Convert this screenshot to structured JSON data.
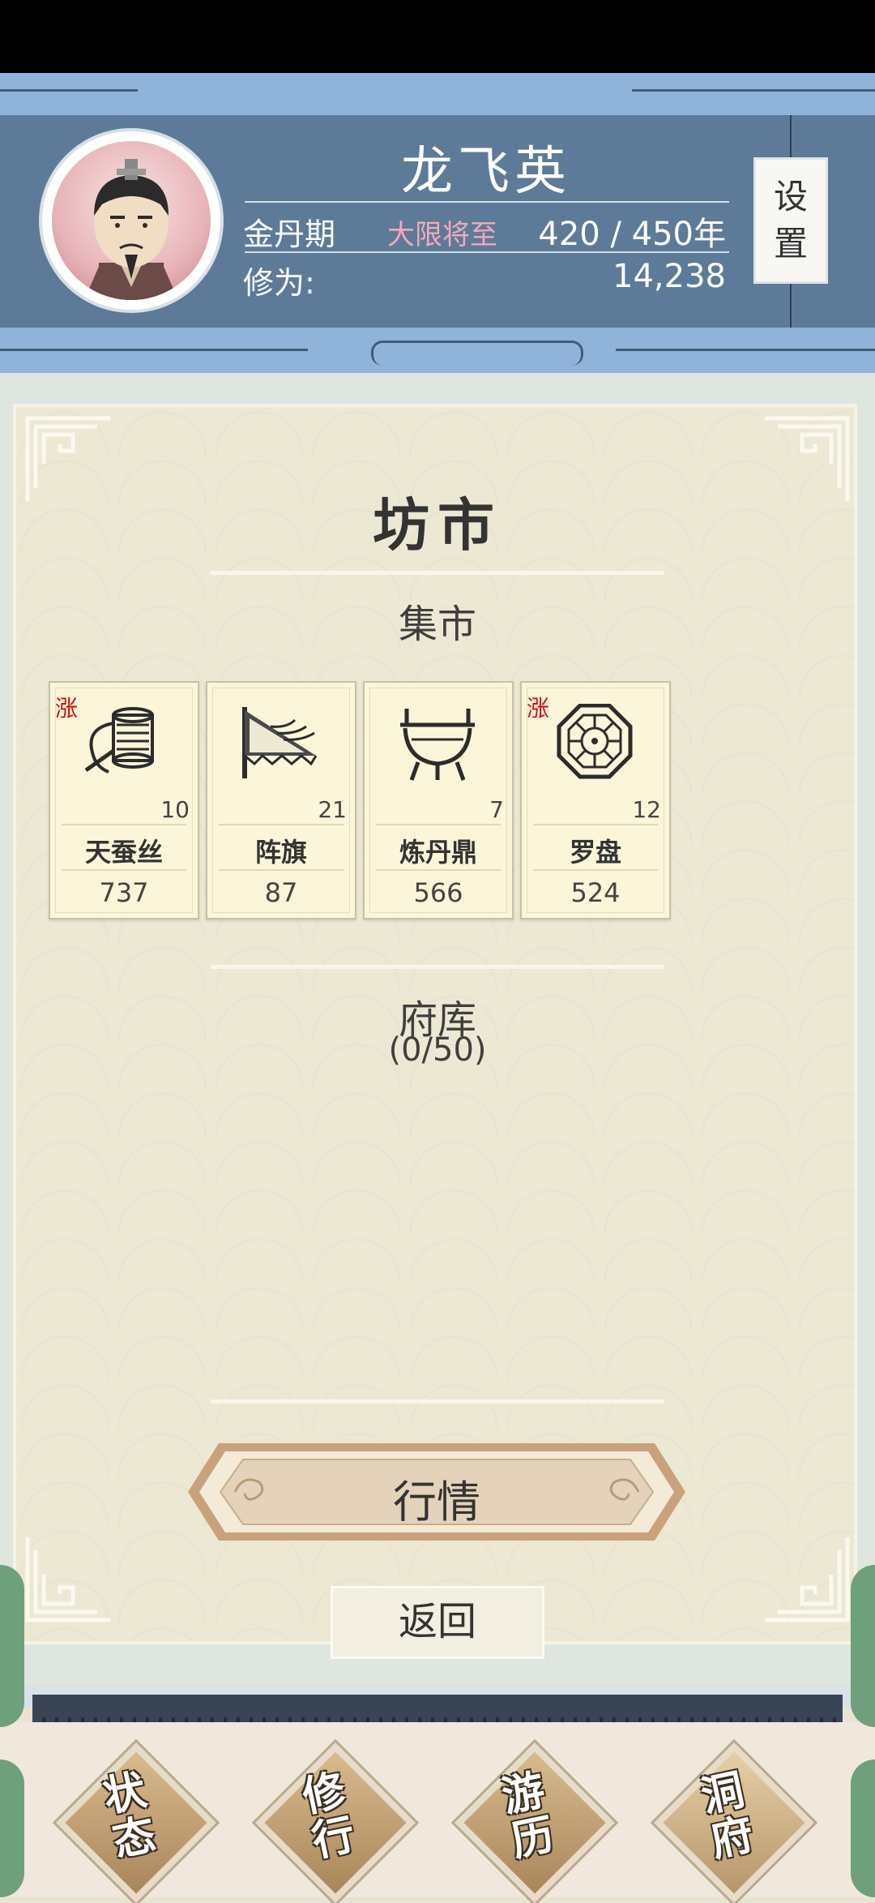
{
  "header": {
    "player_name": "龙飞英",
    "realm": "金丹期",
    "warning": "大限将至",
    "age": "420 / 450年",
    "cultivation_label": "修为:",
    "cultivation_value": "14,238",
    "settings_label": [
      "设",
      "置"
    ]
  },
  "panel": {
    "title": "坊市",
    "market_section": "集市",
    "storage_section": "府库",
    "storage_count": "(0/50)",
    "items": [
      {
        "name": "天蚕丝",
        "qty": "10",
        "price": "737",
        "tag": "涨",
        "icon": "thread-spool-icon"
      },
      {
        "name": "阵旗",
        "qty": "21",
        "price": "87",
        "tag": "",
        "icon": "formation-flag-icon"
      },
      {
        "name": "炼丹鼎",
        "qty": "7",
        "price": "566",
        "tag": "",
        "icon": "alchemy-cauldron-icon"
      },
      {
        "name": "罗盘",
        "qty": "12",
        "price": "524",
        "tag": "涨",
        "icon": "bagua-compass-icon"
      }
    ],
    "market_button": "行情",
    "back_button": "返回"
  },
  "nav": [
    {
      "label": [
        "状",
        "态"
      ]
    },
    {
      "label": [
        "修",
        "行"
      ]
    },
    {
      "label": [
        "游",
        "历"
      ]
    },
    {
      "label": [
        "洞",
        "府"
      ]
    }
  ],
  "colors": {
    "header_bg": "#5d7b98",
    "header_band": "#8fb3d9",
    "panel_bg": "#ede8d4",
    "card_bg": "#fbf5da",
    "price_up_tag": "#d20e0e",
    "warning_text": "#f3a8bd"
  }
}
